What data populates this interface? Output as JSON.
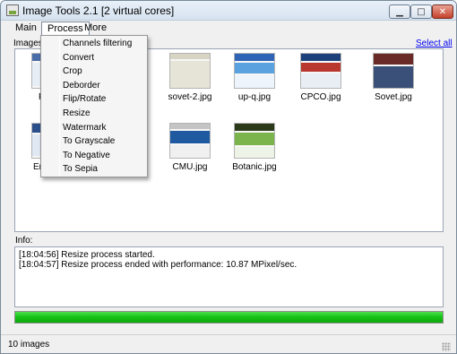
{
  "window": {
    "title": "Image Tools 2.1 [2 virtual cores]",
    "controls": {
      "minimize": "▁",
      "maximize": "□",
      "close": "✕"
    }
  },
  "menu": {
    "main": "Main",
    "process": "Process",
    "more": "More"
  },
  "process_menu": [
    "Channels filtering",
    "Convert",
    "Crop",
    "Deborder",
    "Flip/Rotate",
    "Resize",
    "Watermark",
    "To Grayscale",
    "To Negative",
    "To Sepia"
  ],
  "images": {
    "label": "Images:",
    "select_all": "Select all",
    "items": [
      {
        "name": "sovet-2.jpg"
      },
      {
        "name": "up-q.jpg"
      },
      {
        "name": "CPCO.jpg"
      },
      {
        "name": "Sovet.jpg"
      },
      {
        "name": "CMU.jpg"
      },
      {
        "name": "Botanic.jpg"
      }
    ],
    "partial_labels": [
      "R",
      "En"
    ]
  },
  "info": {
    "label": "Info:",
    "lines": [
      "[18:04:56] Resize process started.",
      "[18:04:57] Resize process ended with performance: 10.87 MPixel/sec."
    ]
  },
  "progress": {
    "value_percent": 100,
    "color": "#14c114"
  },
  "status": {
    "text": "10 images"
  }
}
